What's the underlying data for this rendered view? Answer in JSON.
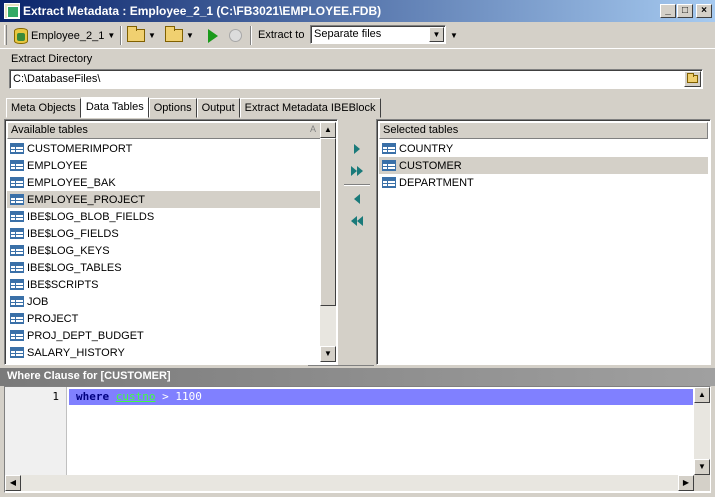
{
  "window": {
    "title": "Extract Metadata : Employee_2_1 (C:\\FB3021\\EMPLOYEE.FDB)",
    "min": "_",
    "max": "□",
    "close": "×"
  },
  "toolbar": {
    "database": "Employee_2_1",
    "extract_to_label": "Extract to",
    "extract_to_value": "Separate files",
    "caret": "▼"
  },
  "directory": {
    "label": "Extract Directory",
    "value": "C:\\DatabaseFiles\\"
  },
  "tabs": [
    {
      "label": "Meta Objects"
    },
    {
      "label": "Data Tables"
    },
    {
      "label": "Options"
    },
    {
      "label": "Output"
    },
    {
      "label": "Extract Metadata IBEBlock"
    }
  ],
  "available": {
    "header": "Available tables",
    "sort_glyph": "A",
    "items": [
      "CUSTOMERIMPORT",
      "EMPLOYEE",
      "EMPLOYEE_BAK",
      "EMPLOYEE_PROJECT",
      "IBE$LOG_BLOB_FIELDS",
      "IBE$LOG_FIELDS",
      "IBE$LOG_KEYS",
      "IBE$LOG_TABLES",
      "IBE$SCRIPTS",
      "JOB",
      "PROJECT",
      "PROJ_DEPT_BUDGET",
      "SALARY_HISTORY"
    ],
    "selected_index": 3
  },
  "selected": {
    "header": "Selected tables",
    "items": [
      "COUNTRY",
      "CUSTOMER",
      "DEPARTMENT"
    ],
    "selected_index": 1
  },
  "where": {
    "title": "Where Clause for [CUSTOMER]",
    "line_number": "1",
    "keyword": "where",
    "identifier": "custno",
    "rest": " > 1100"
  },
  "glyphs": {
    "up": "▲",
    "down": "▼",
    "left": "◀",
    "right": "▶"
  }
}
